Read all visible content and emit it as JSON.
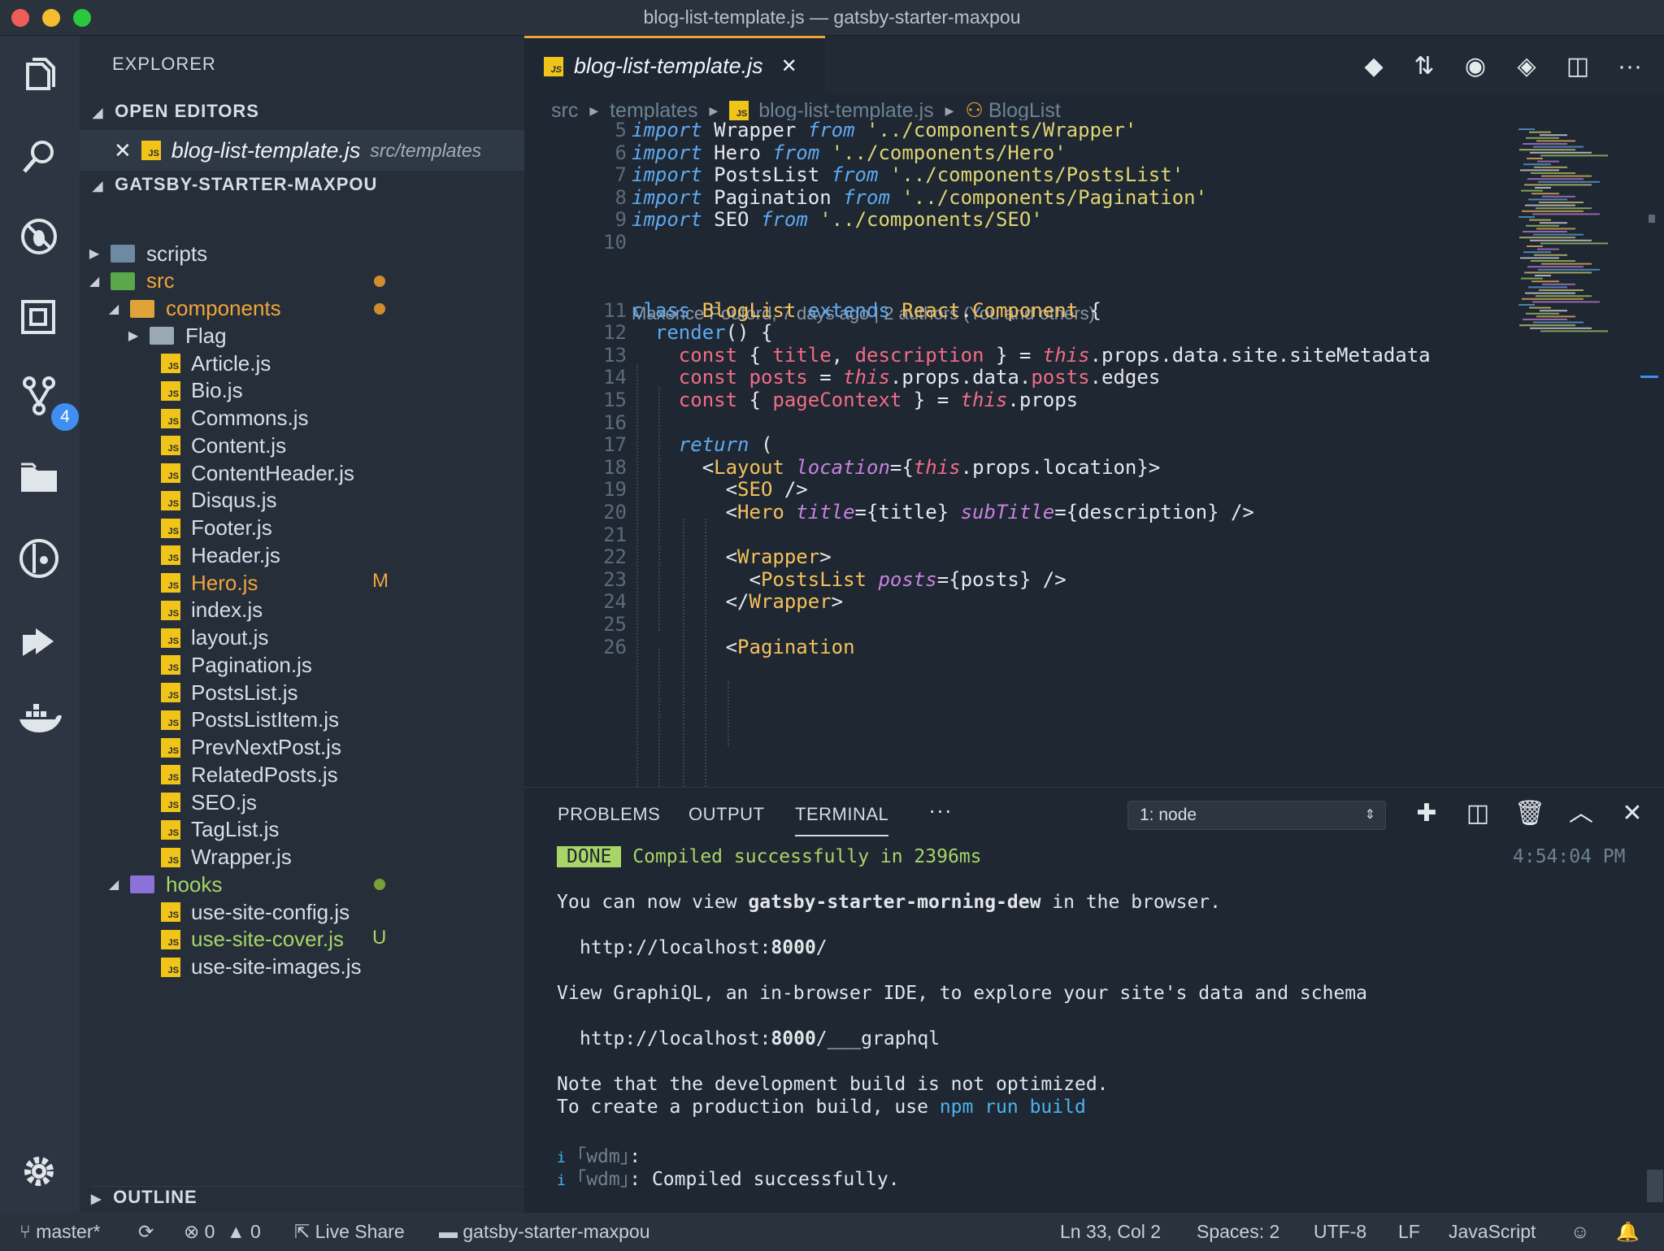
{
  "window": {
    "title": "blog-list-template.js — gatsby-starter-maxpou",
    "colors": {
      "close": "#ee5e57",
      "minimize": "#f4bd2f",
      "zoom": "#29c83f"
    }
  },
  "activity_bar": {
    "items": [
      "files-icon",
      "search-icon",
      "debug-icon",
      "extensions-icon",
      "source-control-icon",
      "folder-icon",
      "gitlens-icon",
      "live-share-icon",
      "docker-icon"
    ],
    "scm_badge": "4",
    "settings": "gear-icon"
  },
  "sidebar": {
    "title": "EXPLORER",
    "open_editors": {
      "label": "OPEN EDITORS",
      "file": "blog-list-template.js",
      "path": "src/templates"
    },
    "project_label": "GATSBY-STARTER-MAXPOU",
    "tree": [
      {
        "name": "scripts",
        "kind": "folder",
        "state": "collapsed",
        "depth": 0
      },
      {
        "name": "src",
        "kind": "folder",
        "state": "expanded",
        "depth": 0,
        "dot": "#d18c30",
        "color": "#f0a53a"
      },
      {
        "name": "components",
        "kind": "folder",
        "state": "expanded",
        "depth": 1,
        "dot": "#d18c30",
        "color": "#f0a53a"
      },
      {
        "name": "Flag",
        "kind": "folder",
        "state": "collapsed",
        "depth": 2
      },
      {
        "name": "Article.js",
        "kind": "js",
        "depth": 2
      },
      {
        "name": "Bio.js",
        "kind": "js",
        "depth": 2
      },
      {
        "name": "Commons.js",
        "kind": "js",
        "depth": 2
      },
      {
        "name": "Content.js",
        "kind": "js",
        "depth": 2
      },
      {
        "name": "ContentHeader.js",
        "kind": "js",
        "depth": 2
      },
      {
        "name": "Disqus.js",
        "kind": "js",
        "depth": 2
      },
      {
        "name": "Footer.js",
        "kind": "js",
        "depth": 2
      },
      {
        "name": "Header.js",
        "kind": "js",
        "depth": 2
      },
      {
        "name": "Hero.js",
        "kind": "js",
        "depth": 2,
        "mark": "M",
        "color": "#f0a53a"
      },
      {
        "name": "index.js",
        "kind": "js",
        "depth": 2
      },
      {
        "name": "layout.js",
        "kind": "js",
        "depth": 2
      },
      {
        "name": "Pagination.js",
        "kind": "js",
        "depth": 2
      },
      {
        "name": "PostsList.js",
        "kind": "js",
        "depth": 2
      },
      {
        "name": "PostsListItem.js",
        "kind": "js",
        "depth": 2
      },
      {
        "name": "PrevNextPost.js",
        "kind": "js",
        "depth": 2
      },
      {
        "name": "RelatedPosts.js",
        "kind": "js",
        "depth": 2
      },
      {
        "name": "SEO.js",
        "kind": "js",
        "depth": 2
      },
      {
        "name": "TagList.js",
        "kind": "js",
        "depth": 2
      },
      {
        "name": "Wrapper.js",
        "kind": "js",
        "depth": 2
      },
      {
        "name": "hooks",
        "kind": "folder",
        "state": "expanded",
        "depth": 1,
        "dot": "#7aa03a",
        "color": "#a8d568"
      },
      {
        "name": "use-site-config.js",
        "kind": "js",
        "depth": 2
      },
      {
        "name": "use-site-cover.js",
        "kind": "js",
        "depth": 2,
        "mark": "U",
        "color": "#a8d568"
      },
      {
        "name": "use-site-images.js",
        "kind": "js",
        "depth": 2
      }
    ],
    "outline_label": "OUTLINE"
  },
  "editor": {
    "tab": "blog-list-template.js",
    "breadcrumb": [
      "src",
      "templates",
      "blog-list-template.js",
      "BlogList"
    ],
    "toolbar_icons": [
      "git-compare-icon",
      "git-toggle-icon",
      "eye-icon",
      "git-commit-icon",
      "split-editor-icon",
      "more-icon"
    ],
    "blame": "Maxence Poutord, 7 days ago | 2 authors (You and others)",
    "lines": [
      {
        "n": "5",
        "code": "import Wrapper from '../components/Wrapper'"
      },
      {
        "n": "6",
        "code": "import Hero from '../components/Hero'"
      },
      {
        "n": "7",
        "code": "import PostsList from '../components/PostsList'"
      },
      {
        "n": "8",
        "code": "import Pagination from '../components/Pagination'"
      },
      {
        "n": "9",
        "code": "import SEO from '../components/SEO'"
      },
      {
        "n": "10",
        "code": ""
      },
      {
        "n": "11",
        "code": "class BlogList extends React.Component {"
      },
      {
        "n": "12",
        "code": "  render() {"
      },
      {
        "n": "13",
        "code": "    const { title, description } = this.props.data.site.siteMetadata"
      },
      {
        "n": "14",
        "code": "    const posts = this.props.data.posts.edges"
      },
      {
        "n": "15",
        "code": "    const { pageContext } = this.props"
      },
      {
        "n": "16",
        "code": ""
      },
      {
        "n": "17",
        "code": "    return ("
      },
      {
        "n": "18",
        "code": "      <Layout location={this.props.location}>"
      },
      {
        "n": "19",
        "code": "        <SEO />"
      },
      {
        "n": "20",
        "code": "        <Hero title={title} subTitle={description} />"
      },
      {
        "n": "21",
        "code": ""
      },
      {
        "n": "22",
        "code": "        <Wrapper>"
      },
      {
        "n": "23",
        "code": "          <PostsList posts={posts} />"
      },
      {
        "n": "24",
        "code": "        </Wrapper>"
      },
      {
        "n": "25",
        "code": ""
      },
      {
        "n": "26",
        "code": "        <Pagination"
      }
    ]
  },
  "panel": {
    "tabs": [
      "PROBLEMS",
      "OUTPUT",
      "TERMINAL"
    ],
    "active_tab": "TERMINAL",
    "more": "···",
    "terminal_select": "1: node",
    "icons": [
      "add-terminal-icon",
      "split-terminal-icon",
      "trash-icon",
      "maximize-icon",
      "close-panel-icon"
    ],
    "terminal": {
      "done_badge": "DONE",
      "compiled": "Compiled successfully in 2396ms",
      "time": "4:54:04 PM",
      "line1_pre": "You can now view ",
      "line1_bold": "gatsby-starter-morning-dew",
      "line1_post": " in the browser.",
      "url1_pre": "http://localhost:",
      "url1_port": "8000",
      "url1_post": "/",
      "line2": "View GraphiQL, an in-browser IDE, to explore your site's data and schema",
      "url2_pre": "http://localhost:",
      "url2_port": "8000",
      "url2_post": "/___graphql",
      "note1": "Note that the development build is not optimized.",
      "note2_pre": "To create a production build, use ",
      "note2_cmd": "npm run build",
      "wdm1_i": "i",
      "wdm1_tag": "｢wdm｣",
      "wdm1_text": ":",
      "wdm2_i": "i",
      "wdm2_tag": "｢wdm｣",
      "wdm2_text": ": Compiled successfully."
    }
  },
  "statusbar": {
    "branch": "master*",
    "errors": "0",
    "warnings": "0",
    "live_share": "Live Share",
    "folder": "gatsby-starter-maxpou",
    "position": "Ln 33, Col 2",
    "spaces": "Spaces: 2",
    "encoding": "UTF-8",
    "eol": "LF",
    "language": "JavaScript"
  }
}
